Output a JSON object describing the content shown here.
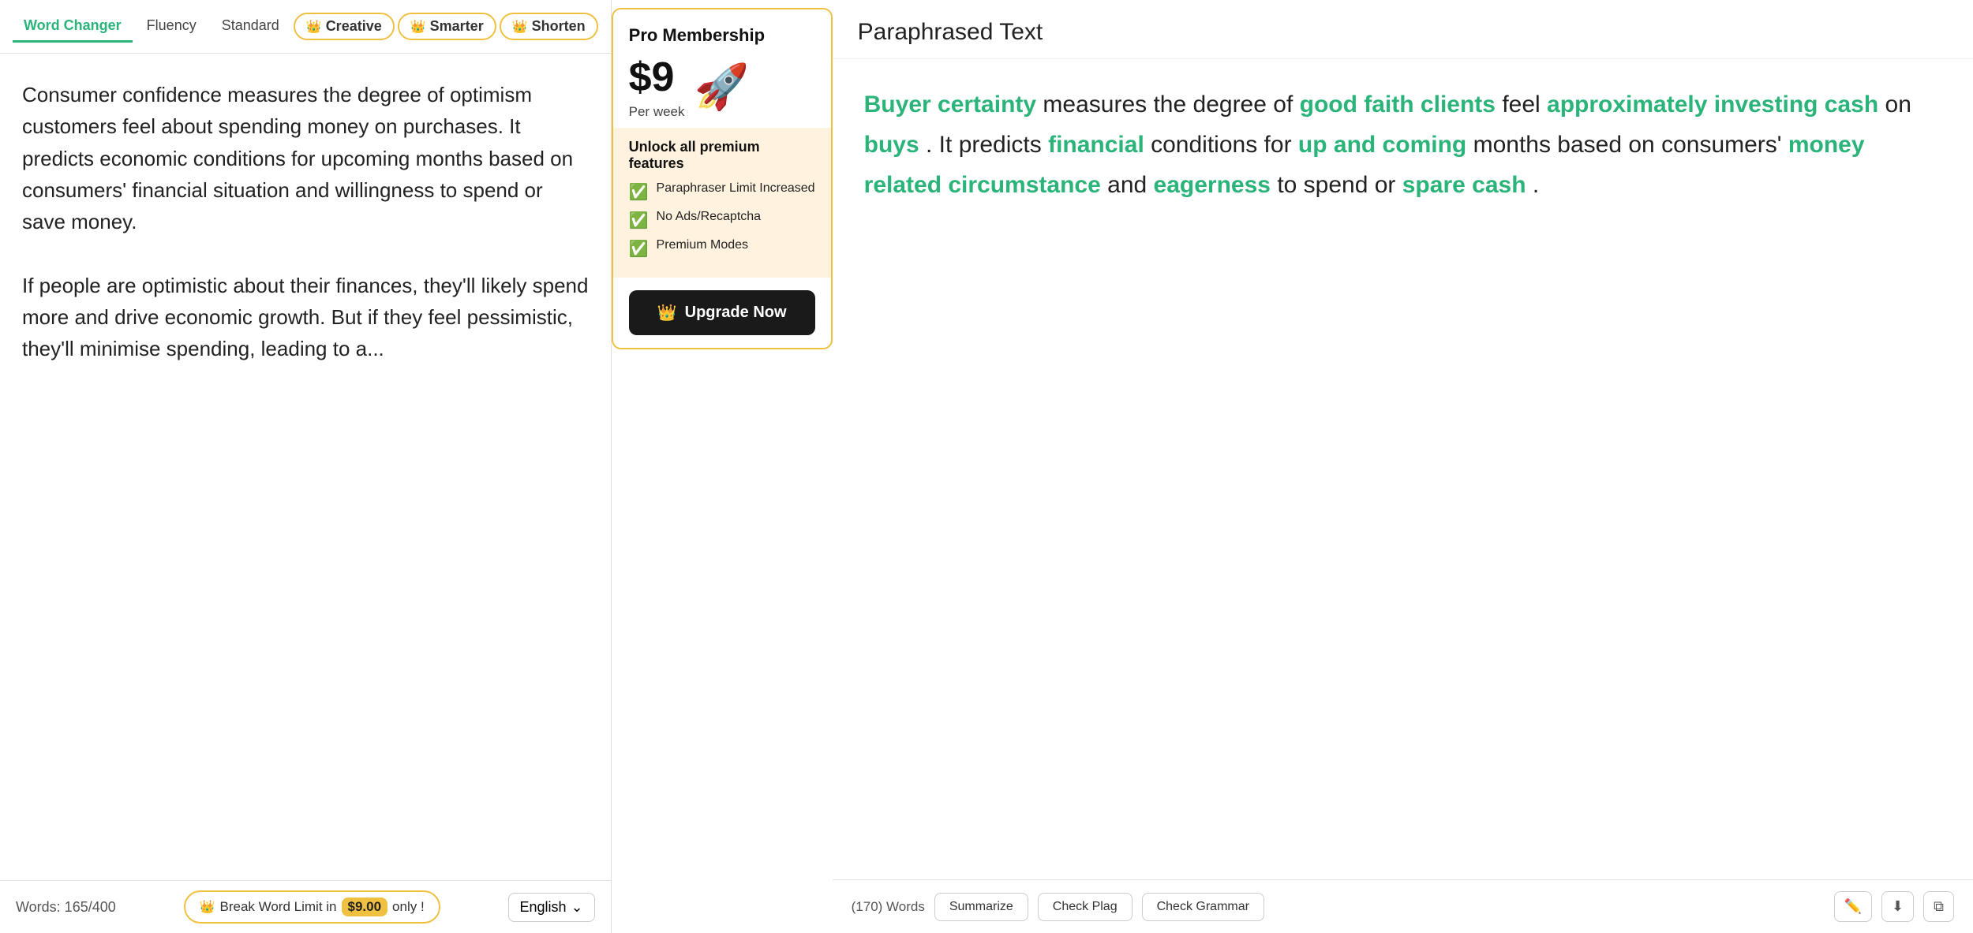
{
  "tabs": [
    {
      "id": "word-changer",
      "label": "Word Changer",
      "active": true,
      "premium": false
    },
    {
      "id": "fluency",
      "label": "Fluency",
      "active": false,
      "premium": false
    },
    {
      "id": "standard",
      "label": "Standard",
      "active": false,
      "premium": false
    },
    {
      "id": "creative",
      "label": "Creative",
      "active": false,
      "premium": true
    },
    {
      "id": "smarter",
      "label": "Smarter",
      "active": false,
      "premium": true
    },
    {
      "id": "shorten",
      "label": "Shorten",
      "active": false,
      "premium": true
    }
  ],
  "input_text_p1": "Consumer confidence measures the degree of optimism customers feel about spending money on purchases. It predicts economic conditions for upcoming months based on consumers' financial situation and willingness to spend or save money.",
  "input_text_p2": "If people are optimistic about their finances, they'll likely spend more and drive economic growth. But if they feel pessimistic, they'll minimise spending, leading to a...",
  "bottom_bar": {
    "word_count": "Words: 165/400",
    "break_limit_prefix": "Break Word Limit in",
    "price": "$9.00",
    "break_limit_suffix": "only !",
    "language": "English"
  },
  "pro_membership": {
    "title": "Pro Membership",
    "price": "$9",
    "per_week": "Per week",
    "unlock_title": "Unlock all premium features",
    "features": [
      "Paraphraser Limit Increased",
      "No Ads/Recaptcha",
      "Premium Modes"
    ],
    "upgrade_label": "Upgrade Now"
  },
  "paraphrased": {
    "header": "Paraphrased Text",
    "word_count": "(170) Words",
    "content_parts": [
      {
        "text": "Buyer certainty",
        "highlight": true
      },
      {
        "text": " measures the degree of ",
        "highlight": false
      },
      {
        "text": "good faith clients",
        "highlight": true
      },
      {
        "text": " feel ",
        "highlight": false
      },
      {
        "text": "approximately investing cash",
        "highlight": true
      },
      {
        "text": " on ",
        "highlight": false
      },
      {
        "text": "buys",
        "highlight": true
      },
      {
        "text": ". It predicts ",
        "highlight": false
      },
      {
        "text": "financial",
        "highlight": true
      },
      {
        "text": " conditions for ",
        "highlight": false
      },
      {
        "text": "up and coming",
        "highlight": true
      },
      {
        "text": " months based on consumers' ",
        "highlight": false
      },
      {
        "text": "money related circumstance",
        "highlight": true
      },
      {
        "text": " and ",
        "highlight": false
      },
      {
        "text": "eagerness",
        "highlight": true
      },
      {
        "text": " to spend or ",
        "highlight": false
      },
      {
        "text": "spare cash",
        "highlight": true
      },
      {
        "text": ".",
        "highlight": false
      }
    ],
    "actions": [
      "Summarize",
      "Check Plag",
      "Check Grammar"
    ],
    "icons": [
      "edit-icon",
      "download-icon",
      "copy-icon"
    ]
  }
}
